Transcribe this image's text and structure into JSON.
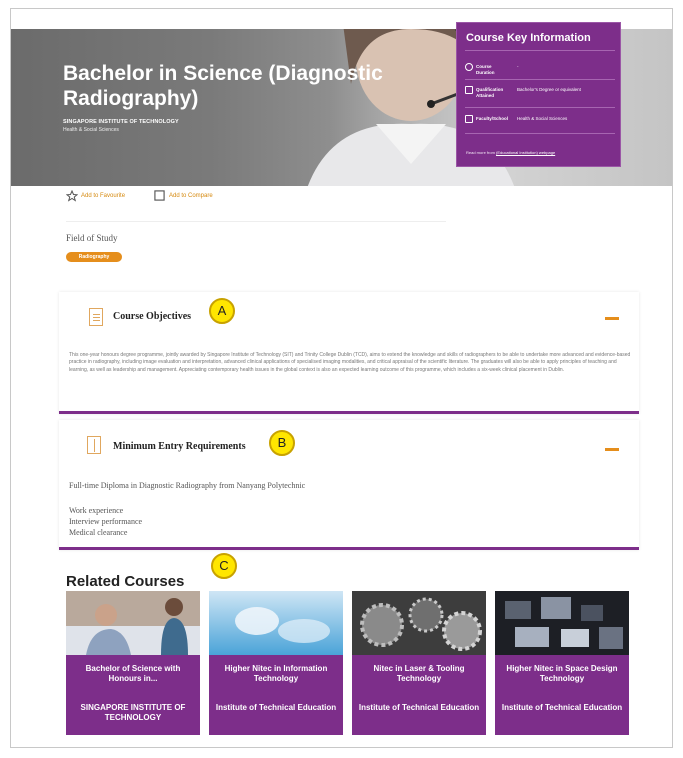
{
  "hero": {
    "title": "Bachelor in Science (Diagnostic Radiography)",
    "institution": "SINGAPORE INSTITUTE OF TECHNOLOGY",
    "faculty": "Health & Social Sciences"
  },
  "key_info": {
    "title": "Course Key Information",
    "rows": [
      {
        "label": "Course Duration",
        "value": "-"
      },
      {
        "label": "Qualification Attained",
        "value": "Bachelor's Degree or equivalent"
      },
      {
        "label": "Faculty/School",
        "value": "Health & Social Sciences"
      }
    ],
    "footer_text": "Read more from ",
    "footer_link": "(Educational Institution) webpage"
  },
  "actions": {
    "favourite": "Add to Favourite",
    "compare": "Add to Compare"
  },
  "field_of_study": {
    "label": "Field of Study",
    "badge": "Radiography"
  },
  "objectives": {
    "title": "Course Objectives",
    "callout": "A",
    "text": "This one-year honours degree programme, jointly awarded by Singapore Institute of Technology (SIT) and Trinity College Dublin (TCD), aims to extend the knowledge and skills of radiographers to be able to undertake more advanced and evidence-based practice in radiography, including image evaluation and interpretation, advanced clinical applications of specialised imaging modalities, and critical appraisal of the scientific literature. The graduates will also be able to apply principles of teaching and learning, as well as leadership and management. Appreciating contemporary health issues in the global context is also an expected learning outcome of this programme, which includes a six-week clinical placement in Dublin."
  },
  "requirements": {
    "title": "Minimum Entry Requirements",
    "callout": "B",
    "diploma": "Full-time Diploma in Diagnostic Radiography from Nanyang Polytechnic",
    "items": [
      "Work experience",
      "Interview performance",
      "Medical clearance"
    ]
  },
  "related": {
    "title": "Related Courses",
    "callout": "C",
    "cards": [
      {
        "title": "Bachelor of Science with Honours in...",
        "institution": "SINGAPORE INSTITUTE OF TECHNOLOGY"
      },
      {
        "title": "Higher Nitec in Information Technology",
        "institution": "Institute of Technical Education"
      },
      {
        "title": "Nitec in Laser & Tooling Technology",
        "institution": "Institute of Technical Education"
      },
      {
        "title": "Higher Nitec in Space Design Technology",
        "institution": "Institute of Technical Education"
      }
    ]
  },
  "colors": {
    "purple": "#7d2e8a",
    "orange": "#e58e1c",
    "callout_yellow": "#ffe600"
  }
}
